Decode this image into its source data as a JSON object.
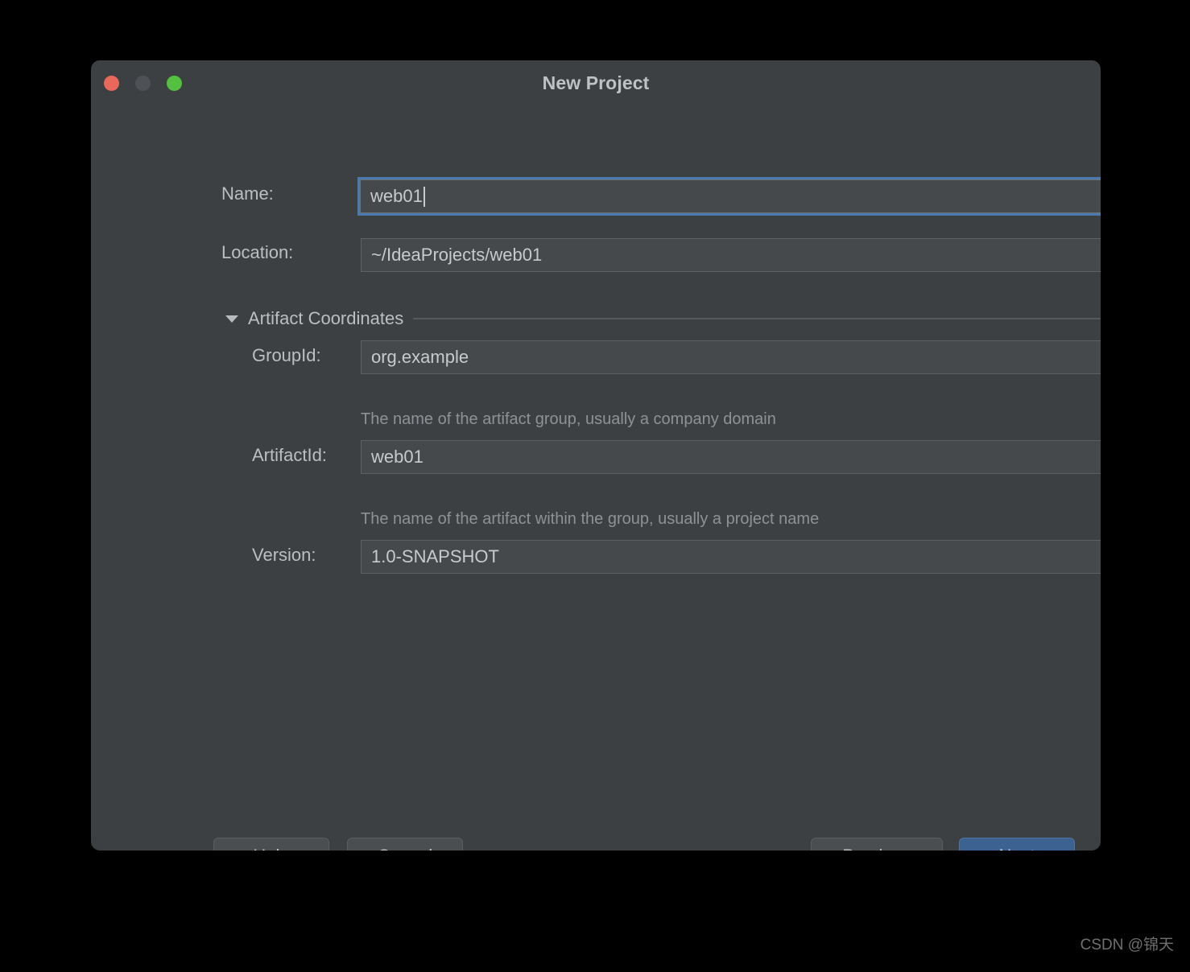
{
  "window": {
    "title": "New Project",
    "traffic_lights": [
      {
        "name": "close",
        "color": "#e8685c"
      },
      {
        "name": "minimize",
        "color": "#4e5156"
      },
      {
        "name": "maximize",
        "color": "#53c13f"
      }
    ]
  },
  "form": {
    "name": {
      "label": "Name:",
      "value": "web01",
      "focused": true
    },
    "location": {
      "label": "Location:",
      "value": "~/IdeaProjects/web01",
      "browse_icon": "folder-open-icon"
    },
    "artifact_section": {
      "title": "Artifact Coordinates",
      "expanded": true,
      "toggle_icon": "triangle-down-icon"
    },
    "group_id": {
      "label": "GroupId:",
      "value": "org.example",
      "hint": "The name of the artifact group, usually a company domain"
    },
    "artifact_id": {
      "label": "ArtifactId:",
      "value": "web01",
      "hint": "The name of the artifact within the group, usually a project name"
    },
    "version": {
      "label": "Version:",
      "value": "1.0-SNAPSHOT"
    }
  },
  "footer": {
    "help": "Help",
    "cancel": "Cancel",
    "previous": "Previous",
    "next": "Next"
  },
  "watermark": "CSDN @锦天",
  "colors": {
    "dialog_background": "#3c4043",
    "field_background": "#45494c",
    "accent_focus": "#4a7aab",
    "primary_button": "#3c6291",
    "label_text": "#bcbfc2",
    "hint_text": "#8f9295"
  }
}
